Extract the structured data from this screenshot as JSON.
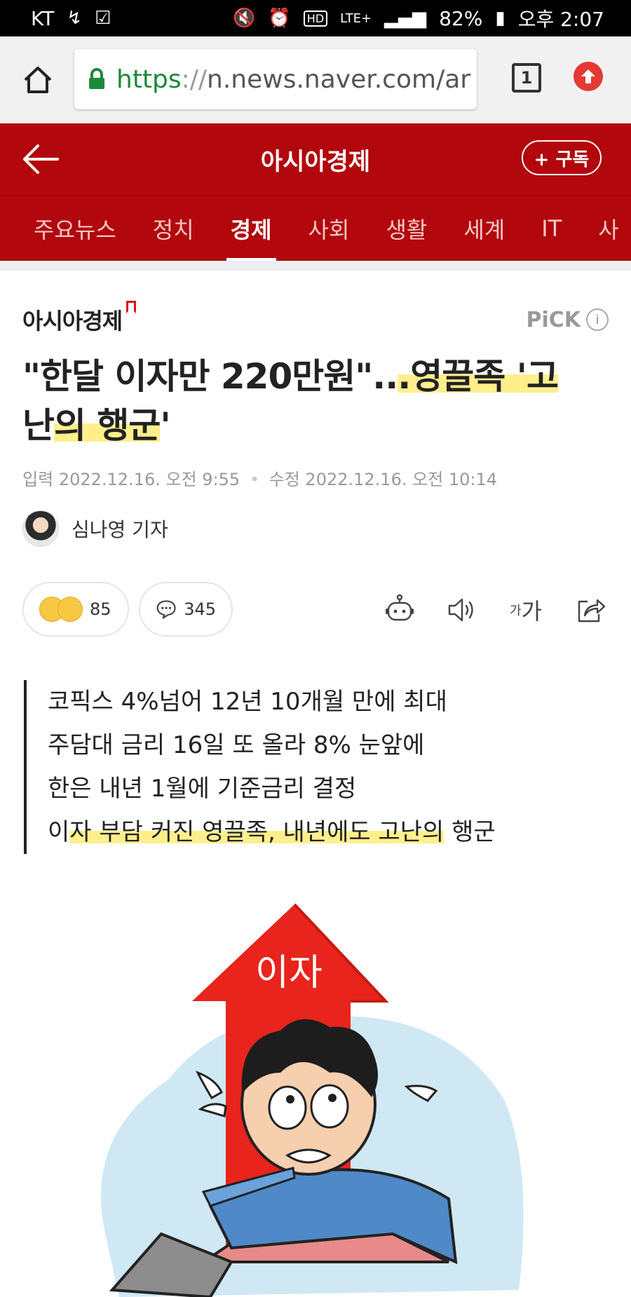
{
  "status_bar": {
    "carrier": "KT",
    "battery": "82%",
    "time": "오후 2:07",
    "network": "LTE+"
  },
  "browser": {
    "url_scheme": "https",
    "url_sep": "://",
    "url_rest": "n.news.naver.com/ar",
    "tab_count": "1"
  },
  "news_header": {
    "title": "아시아경제",
    "subscribe_label": "+ 구독"
  },
  "categories": [
    "주요뉴스",
    "정치",
    "경제",
    "사회",
    "생활",
    "세계",
    "IT",
    "사"
  ],
  "active_category": "경제",
  "article": {
    "press": "아시아경제",
    "pick_label": "PiCK",
    "pick_info": "i",
    "headline_part1": "\"한달 이자만 220만원\"..",
    "headline_part2": ".영끌족 '고",
    "headline_part3": "난",
    "headline_part4": "의 행군",
    "headline_part5": "'",
    "input_label": "입력",
    "input_time": "2022.12.16. 오전 9:55",
    "modified_label": "수정",
    "modified_time": "2022.12.16. 오전 10:14",
    "reporter": "심나영 기자",
    "reaction_count": "85",
    "comment_count": "345",
    "font_size_label_small": "가",
    "font_size_label_big": "가",
    "summary_1": "코픽스 4%넘어 12년 10개월 만에 최대",
    "summary_2": "주담대 금리 16일 또 올라 8% 눈앞에",
    "summary_3": "한은 내년 1월에 기준금리 결정",
    "summary_4a": "이",
    "summary_4b": "자 부담 커진 영끌족, 내년에도 고난의",
    "summary_4c": " 행군",
    "illustration_text": "이자"
  },
  "colors": {
    "brand_red": "#b2070c",
    "highlight": "#ffec78",
    "url_green": "#1a8a3a"
  }
}
